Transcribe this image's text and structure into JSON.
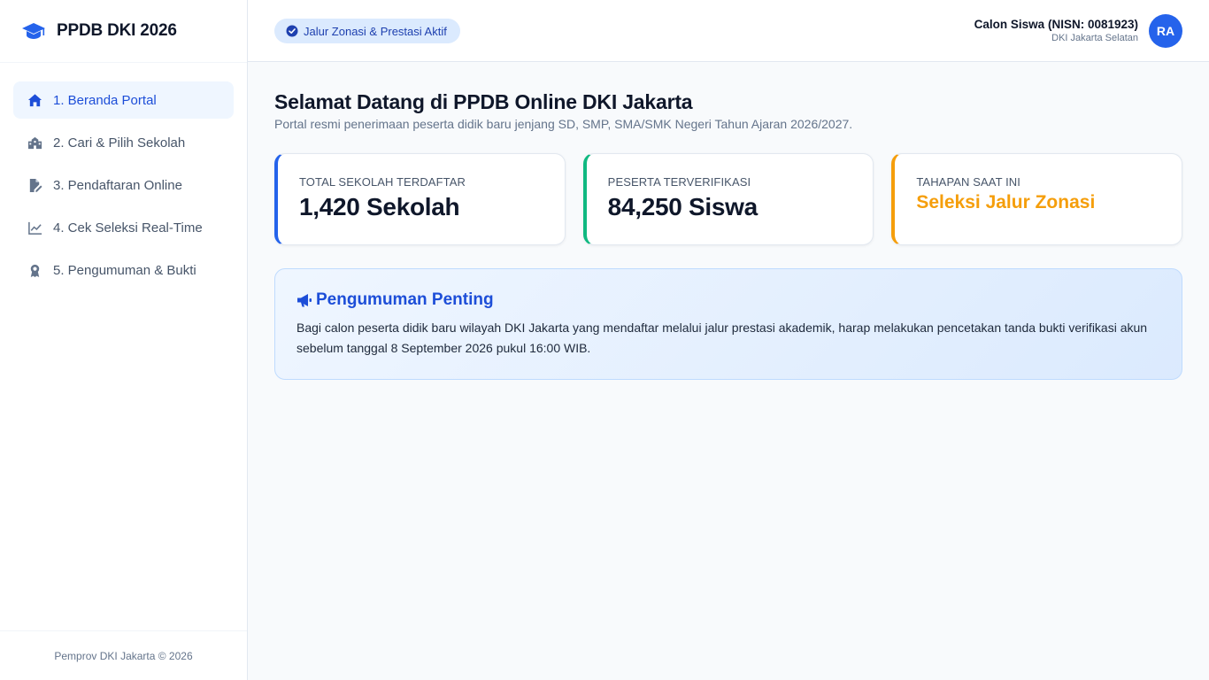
{
  "brand": {
    "name": "PPDB DKI 2026",
    "icon": "graduation-cap-icon"
  },
  "sidebar": {
    "items": [
      {
        "label": "1. Beranda Portal",
        "icon": "home-icon",
        "active": true
      },
      {
        "label": "2. Cari & Pilih Sekolah",
        "icon": "school-icon",
        "active": false
      },
      {
        "label": "3. Pendaftaran Online",
        "icon": "file-edit-icon",
        "active": false
      },
      {
        "label": "4. Cek Seleksi Real-Time",
        "icon": "line-chart-icon",
        "active": false
      },
      {
        "label": "5. Pengumuman & Bukti",
        "icon": "award-icon",
        "active": false
      }
    ],
    "footer": "Pemprov DKI Jakarta © 2026"
  },
  "header": {
    "status_pill": "Jalur Zonasi & Prestasi Aktif",
    "user_name": "Calon Siswa (NISN: 0081923)",
    "user_region": "DKI Jakarta Selatan",
    "avatar_initials": "RA"
  },
  "main": {
    "title": "Selamat Datang di PPDB Online DKI Jakarta",
    "subtitle": "Portal resmi penerimaan peserta didik baru jenjang SD, SMP, SMA/SMK Negeri Tahun Ajaran 2026/2027.",
    "stats": [
      {
        "label": "TOTAL SEKOLAH TERDAFTAR",
        "value": "1,420 Sekolah",
        "color": "#2563eb"
      },
      {
        "label": "PESERTA TERVERIFIKASI",
        "value": "84,250 Siswa",
        "color": "#10b981"
      },
      {
        "label": "TAHAPAN SAAT INI",
        "value": "Seleksi Jalur Zonasi",
        "color": "#f59e0b"
      }
    ],
    "announcement": {
      "title": "Pengumuman Penting",
      "body": "Bagi calon peserta didik baru wilayah DKI Jakarta yang mendaftar melalui jalur prestasi akademik, harap melakukan pencetakan tanda bukti verifikasi akun sebelum tanggal 8 September 2026 pukul 16:00 WIB."
    }
  },
  "colors": {
    "accent": "#2563eb",
    "active_bg": "#eff6ff"
  }
}
